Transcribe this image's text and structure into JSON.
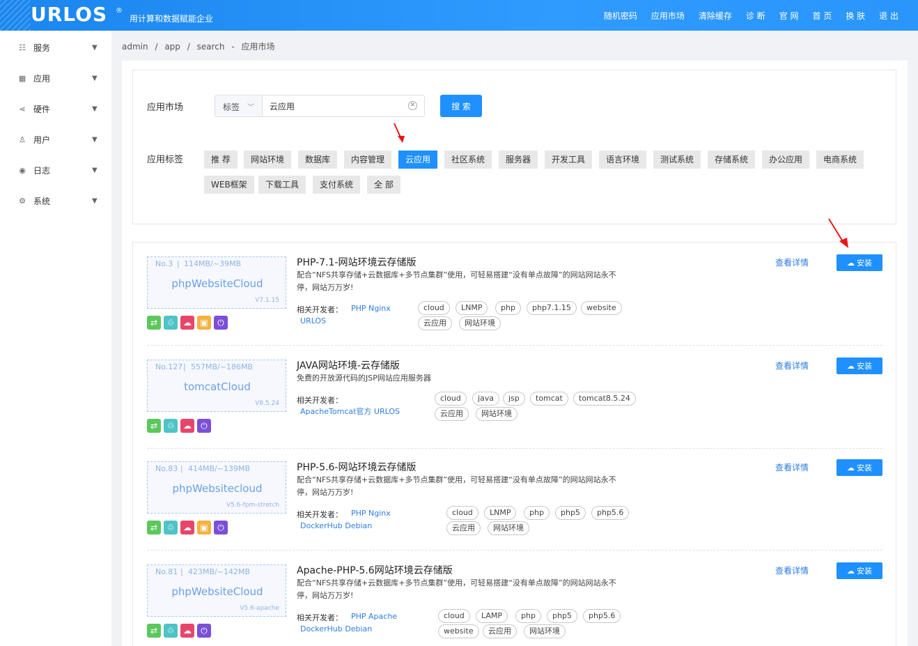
{
  "header": {
    "logo": "URLOS",
    "logo_reg": "®",
    "slogan": "用计算和数据赋能企业",
    "nav": [
      "随机密码",
      "应用市场",
      "清除缓存",
      "诊 断",
      "官 网",
      "首 页",
      "换 肤",
      "退 出"
    ]
  },
  "sidebar": {
    "items": [
      {
        "label": "服务",
        "icon": "grid-icon"
      },
      {
        "label": "应用",
        "icon": "apps-icon"
      },
      {
        "label": "硬件",
        "icon": "share-icon"
      },
      {
        "label": "用户",
        "icon": "user-icon"
      },
      {
        "label": "日志",
        "icon": "eye-icon"
      },
      {
        "label": "系统",
        "icon": "gear-icon"
      }
    ]
  },
  "breadcrumb": [
    "admin",
    "/",
    "app",
    "/",
    "search",
    "-",
    "应用市场"
  ],
  "search": {
    "label": "应用市场",
    "select_value": "标签",
    "value": "云应用",
    "button": "搜 索"
  },
  "tags": {
    "label": "应用标签",
    "items": [
      "推 荐",
      "网站环境",
      "数据库",
      "内容管理",
      "云应用",
      "社区系统",
      "服务器",
      "开发工具",
      "语言环境",
      "测试系统",
      "存储系统",
      "办公应用",
      "电商系统",
      "WEB框架",
      "下载工具",
      "支付系统",
      "全 部"
    ],
    "active": "云应用"
  },
  "common": {
    "detail": "查看详情",
    "install": "安装",
    "dev_label": "相关开发者："
  },
  "apps": [
    {
      "no": "No.3",
      "size": "114MB/~39MB",
      "name": "phpWebsiteCloud",
      "version": "V7.1.15",
      "title": "PHP-7.1-网站环境云存储版",
      "desc": "配合“NFS共享存储+云数据库+多节点集群”使用，可轻易搭建“没有单点故障”的网站网站永不停，网站万万岁!",
      "devs_line1": "PHP  Nginx",
      "devs_line2": "URLOS",
      "tags": [
        "cloud",
        "LNMP",
        "php",
        "php7.1.15",
        "website",
        "云应用",
        "网站环境"
      ]
    },
    {
      "no": "No.127",
      "size": "557MB/~186MB",
      "name": "tomcatCloud",
      "version": "V8.5.24",
      "title": "JAVA网站环境-云存储版",
      "desc": "免费的开放源代码的JSP网站应用服务器",
      "devs_line1": "ApacheTomcat官方  URLOS",
      "devs_line2": "",
      "tags": [
        "cloud",
        "java",
        "jsp",
        "tomcat",
        "tomcat8.5.24",
        "云应用",
        "网站环境"
      ]
    },
    {
      "no": "No.83",
      "size": "414MB/~139MB",
      "name": "phpWebsitecloud",
      "version": "V5.6-fpm-stretch",
      "title": "PHP-5.6-网站环境云存储版",
      "desc": "配合“NFS共享存储+云数据库+多节点集群”使用，可轻易搭建“没有单点故障”的网站网站永不停，网站万万岁!",
      "devs_line1": "PHP  Nginx",
      "devs_line2": "DockerHub  Debian",
      "tags": [
        "cloud",
        "LNMP",
        "php",
        "php5",
        "php5.6",
        "云应用",
        "网站环境"
      ]
    },
    {
      "no": "No.81",
      "size": "423MB/~142MB",
      "name": "phpWebsiteCloud",
      "version": "V5.6-apache",
      "title": "Apache-PHP-5.6网站环境云存储版",
      "desc": "配合“NFS共享存储+云数据库+多节点集群”使用，可轻易搭建“没有单点故障”的网站网站永不停，网站万万岁!",
      "devs_line1": "PHP  Apache",
      "devs_line2": "DockerHub  Debian",
      "tags": [
        "cloud",
        "LAMP",
        "php",
        "php5",
        "php5.6",
        "website",
        "云应用",
        "网站环境"
      ]
    }
  ]
}
